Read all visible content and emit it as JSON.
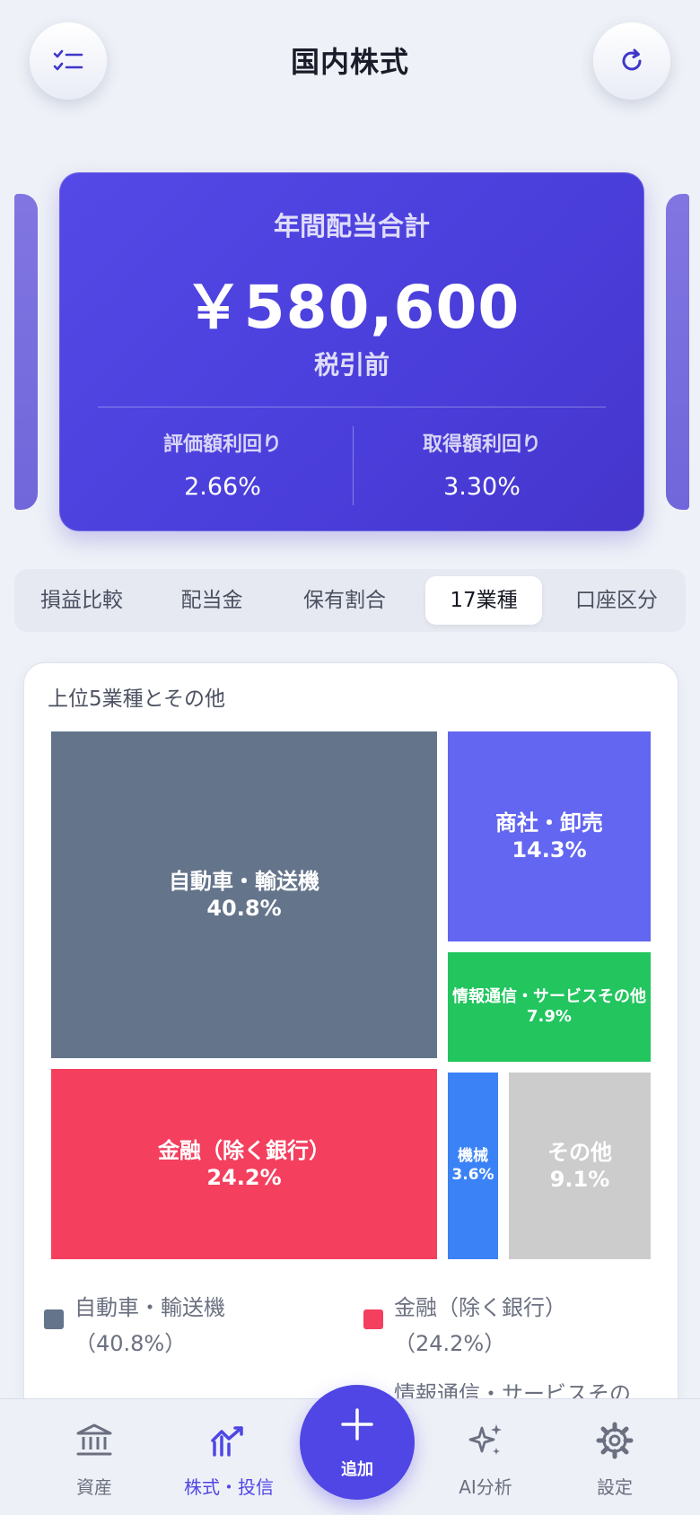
{
  "header": {
    "title": "国内株式",
    "left_icon": "checklist-icon",
    "right_icon": "refresh-icon"
  },
  "hero": {
    "label": "年間配当合計",
    "amount": "￥580,600",
    "sub": "税引前",
    "metrics": [
      {
        "label": "評価額利回り",
        "value": "2.66%"
      },
      {
        "label": "取得額利回り",
        "value": "3.30%"
      }
    ]
  },
  "tabs": [
    {
      "label": "損益比較",
      "active": false
    },
    {
      "label": "配当金",
      "active": false
    },
    {
      "label": "保有割合",
      "active": false
    },
    {
      "label": "17業種",
      "active": true
    },
    {
      "label": "口座区分",
      "active": false
    }
  ],
  "chart_card": {
    "title": "上位5業種とその他"
  },
  "chart_data": {
    "type": "treemap",
    "title": "上位5業種とその他",
    "items": [
      {
        "name": "自動車・輸送機",
        "value": 40.8,
        "label": "40.8%",
        "color": "#64748b"
      },
      {
        "name": "金融（除く銀行）",
        "value": 24.2,
        "label": "24.2%",
        "color": "#f43f5e"
      },
      {
        "name": "商社・卸売",
        "value": 14.3,
        "label": "14.3%",
        "color": "#6366f1"
      },
      {
        "name": "情報通信・サービスその他",
        "value": 7.9,
        "label": "7.9%",
        "color": "#22c55e"
      },
      {
        "name": "機械",
        "value": 3.6,
        "label": "3.6%",
        "color": "#3b82f6"
      },
      {
        "name": "その他",
        "value": 9.1,
        "label": "9.1%",
        "color": "#cccccc"
      }
    ],
    "legend": [
      {
        "line1": "自動車・輸送機",
        "line2": "（40.8%）",
        "color": "#64748b"
      },
      {
        "line1": "金融（除く銀行）",
        "line2": "（24.2%）",
        "color": "#f43f5e"
      },
      {
        "line1": "情報通信・サービスその",
        "line2": "",
        "color": "#6366f1"
      }
    ]
  },
  "nav": {
    "items": [
      {
        "label": "資産",
        "icon": "bank-icon",
        "active": false
      },
      {
        "label": "株式・投信",
        "icon": "chart-trend-icon",
        "active": true
      },
      {
        "label": "AI分析",
        "icon": "sparkles-icon",
        "active": false
      },
      {
        "label": "設定",
        "icon": "gear-icon",
        "active": false
      }
    ],
    "fab_label": "追加",
    "fab_icon": "plus-icon"
  }
}
